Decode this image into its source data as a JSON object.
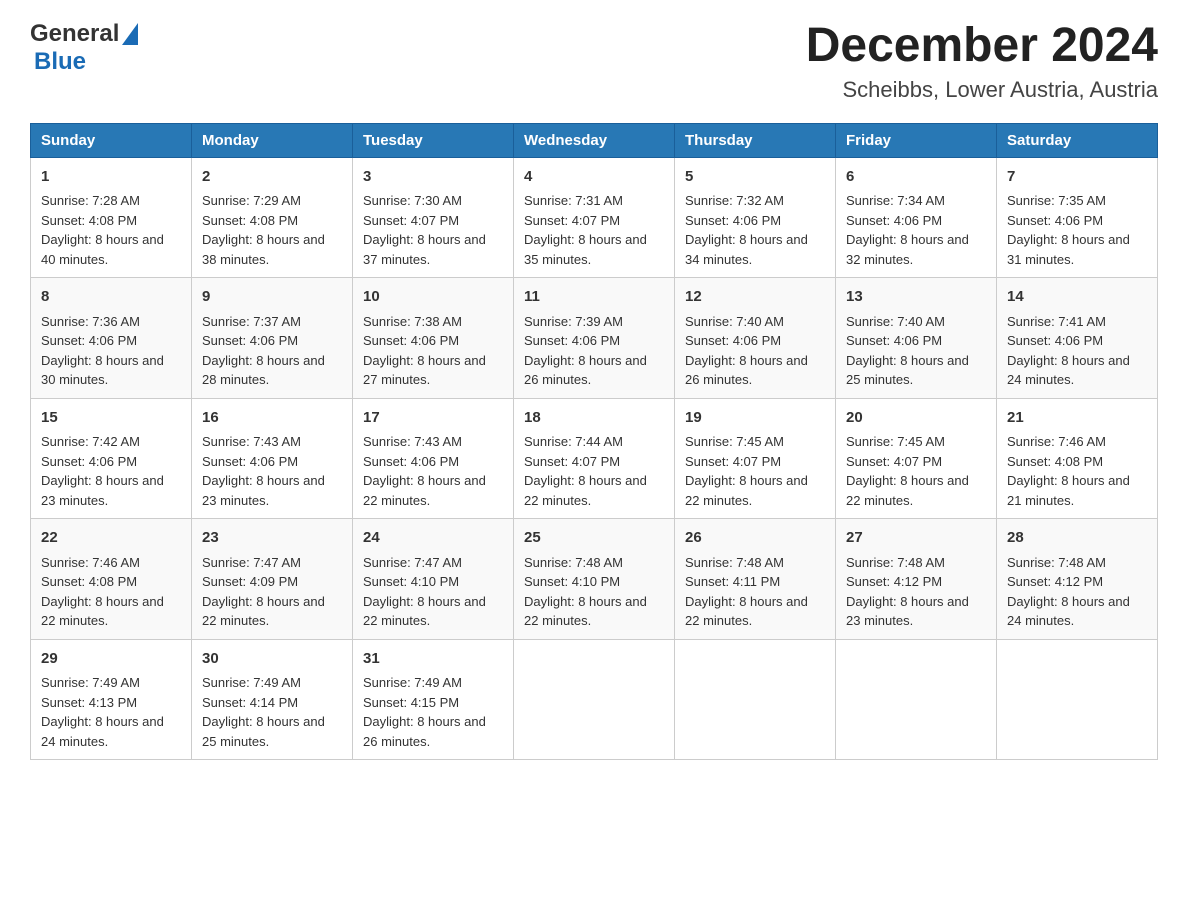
{
  "header": {
    "logo_general": "General",
    "logo_blue": "Blue",
    "month_year": "December 2024",
    "location": "Scheibbs, Lower Austria, Austria"
  },
  "weekdays": [
    "Sunday",
    "Monday",
    "Tuesday",
    "Wednesday",
    "Thursday",
    "Friday",
    "Saturday"
  ],
  "weeks": [
    [
      {
        "day": "1",
        "sunrise": "7:28 AM",
        "sunset": "4:08 PM",
        "daylight": "8 hours and 40 minutes."
      },
      {
        "day": "2",
        "sunrise": "7:29 AM",
        "sunset": "4:08 PM",
        "daylight": "8 hours and 38 minutes."
      },
      {
        "day": "3",
        "sunrise": "7:30 AM",
        "sunset": "4:07 PM",
        "daylight": "8 hours and 37 minutes."
      },
      {
        "day": "4",
        "sunrise": "7:31 AM",
        "sunset": "4:07 PM",
        "daylight": "8 hours and 35 minutes."
      },
      {
        "day": "5",
        "sunrise": "7:32 AM",
        "sunset": "4:06 PM",
        "daylight": "8 hours and 34 minutes."
      },
      {
        "day": "6",
        "sunrise": "7:34 AM",
        "sunset": "4:06 PM",
        "daylight": "8 hours and 32 minutes."
      },
      {
        "day": "7",
        "sunrise": "7:35 AM",
        "sunset": "4:06 PM",
        "daylight": "8 hours and 31 minutes."
      }
    ],
    [
      {
        "day": "8",
        "sunrise": "7:36 AM",
        "sunset": "4:06 PM",
        "daylight": "8 hours and 30 minutes."
      },
      {
        "day": "9",
        "sunrise": "7:37 AM",
        "sunset": "4:06 PM",
        "daylight": "8 hours and 28 minutes."
      },
      {
        "day": "10",
        "sunrise": "7:38 AM",
        "sunset": "4:06 PM",
        "daylight": "8 hours and 27 minutes."
      },
      {
        "day": "11",
        "sunrise": "7:39 AM",
        "sunset": "4:06 PM",
        "daylight": "8 hours and 26 minutes."
      },
      {
        "day": "12",
        "sunrise": "7:40 AM",
        "sunset": "4:06 PM",
        "daylight": "8 hours and 26 minutes."
      },
      {
        "day": "13",
        "sunrise": "7:40 AM",
        "sunset": "4:06 PM",
        "daylight": "8 hours and 25 minutes."
      },
      {
        "day": "14",
        "sunrise": "7:41 AM",
        "sunset": "4:06 PM",
        "daylight": "8 hours and 24 minutes."
      }
    ],
    [
      {
        "day": "15",
        "sunrise": "7:42 AM",
        "sunset": "4:06 PM",
        "daylight": "8 hours and 23 minutes."
      },
      {
        "day": "16",
        "sunrise": "7:43 AM",
        "sunset": "4:06 PM",
        "daylight": "8 hours and 23 minutes."
      },
      {
        "day": "17",
        "sunrise": "7:43 AM",
        "sunset": "4:06 PM",
        "daylight": "8 hours and 22 minutes."
      },
      {
        "day": "18",
        "sunrise": "7:44 AM",
        "sunset": "4:07 PM",
        "daylight": "8 hours and 22 minutes."
      },
      {
        "day": "19",
        "sunrise": "7:45 AM",
        "sunset": "4:07 PM",
        "daylight": "8 hours and 22 minutes."
      },
      {
        "day": "20",
        "sunrise": "7:45 AM",
        "sunset": "4:07 PM",
        "daylight": "8 hours and 22 minutes."
      },
      {
        "day": "21",
        "sunrise": "7:46 AM",
        "sunset": "4:08 PM",
        "daylight": "8 hours and 21 minutes."
      }
    ],
    [
      {
        "day": "22",
        "sunrise": "7:46 AM",
        "sunset": "4:08 PM",
        "daylight": "8 hours and 22 minutes."
      },
      {
        "day": "23",
        "sunrise": "7:47 AM",
        "sunset": "4:09 PM",
        "daylight": "8 hours and 22 minutes."
      },
      {
        "day": "24",
        "sunrise": "7:47 AM",
        "sunset": "4:10 PM",
        "daylight": "8 hours and 22 minutes."
      },
      {
        "day": "25",
        "sunrise": "7:48 AM",
        "sunset": "4:10 PM",
        "daylight": "8 hours and 22 minutes."
      },
      {
        "day": "26",
        "sunrise": "7:48 AM",
        "sunset": "4:11 PM",
        "daylight": "8 hours and 22 minutes."
      },
      {
        "day": "27",
        "sunrise": "7:48 AM",
        "sunset": "4:12 PM",
        "daylight": "8 hours and 23 minutes."
      },
      {
        "day": "28",
        "sunrise": "7:48 AM",
        "sunset": "4:12 PM",
        "daylight": "8 hours and 24 minutes."
      }
    ],
    [
      {
        "day": "29",
        "sunrise": "7:49 AM",
        "sunset": "4:13 PM",
        "daylight": "8 hours and 24 minutes."
      },
      {
        "day": "30",
        "sunrise": "7:49 AM",
        "sunset": "4:14 PM",
        "daylight": "8 hours and 25 minutes."
      },
      {
        "day": "31",
        "sunrise": "7:49 AM",
        "sunset": "4:15 PM",
        "daylight": "8 hours and 26 minutes."
      },
      null,
      null,
      null,
      null
    ]
  ],
  "labels": {
    "sunrise": "Sunrise:",
    "sunset": "Sunset:",
    "daylight": "Daylight:"
  }
}
